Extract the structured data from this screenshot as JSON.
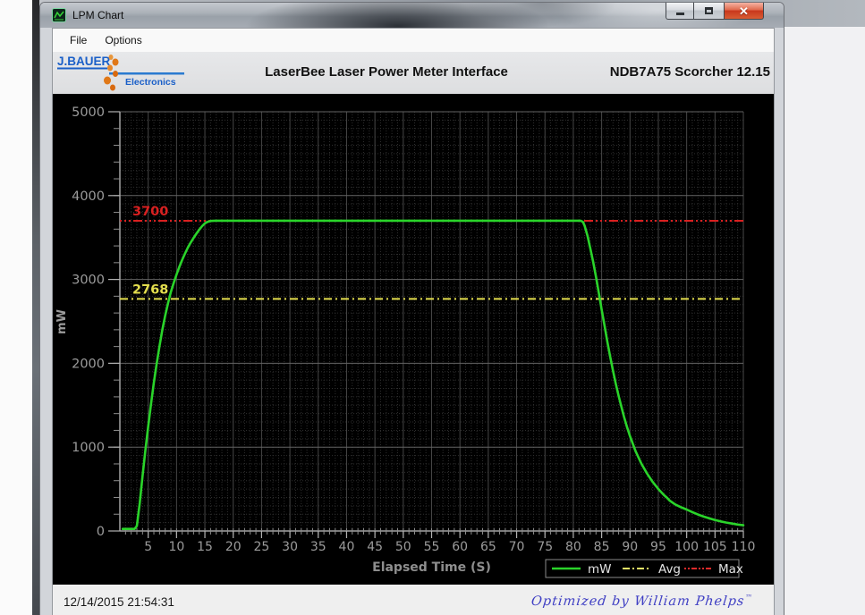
{
  "window": {
    "title": "LPM Chart",
    "buttons": {
      "minimize": "minimize",
      "maximize": "maximize",
      "close": "close"
    }
  },
  "menu": {
    "items": [
      {
        "label": "File"
      },
      {
        "label": "Options"
      }
    ]
  },
  "header": {
    "logo_line1": "J.BAUER",
    "logo_line2": "Electronics",
    "title": "LaserBee Laser Power Meter Interface",
    "version": "NDB7A75 Scorcher 12.15"
  },
  "statusbar": {
    "timestamp": "12/14/2015 21:54:31",
    "credit": "Optimized by William Phelps",
    "credit_tm": "TM"
  },
  "chart_data": {
    "type": "line",
    "xlabel": "Elapsed Time (S)",
    "ylabel": "mW",
    "xlim": [
      0,
      110
    ],
    "ylim": [
      0,
      5000
    ],
    "x_tick_labels": [
      5,
      10,
      15,
      20,
      25,
      30,
      35,
      40,
      45,
      50,
      55,
      60,
      65,
      70,
      75,
      80,
      85,
      90,
      95,
      100,
      105,
      110
    ],
    "y_tick_labels": [
      0,
      1000,
      2000,
      3000,
      4000,
      5000
    ],
    "x_minor_step": 1,
    "y_minor_step": 100,
    "grid": "major solid + minor dotted",
    "legend_position": "bottom-right",
    "legend": [
      {
        "name": "mW",
        "color": "#2ad42a",
        "style": "solid"
      },
      {
        "name": "Avg",
        "color": "#e9e966",
        "style": "dash-dot"
      },
      {
        "name": "Max",
        "color": "#e02a2a",
        "style": "dash-dot"
      }
    ],
    "max_line": {
      "value": 3700,
      "label": "3700",
      "color": "#d92020"
    },
    "avg_line": {
      "value": 2768,
      "label": "2768",
      "color": "#e3de4e"
    },
    "series": [
      {
        "name": "mW",
        "color": "#2ad42a",
        "points": [
          [
            0.5,
            25
          ],
          [
            2.6,
            25
          ],
          [
            3,
            60
          ],
          [
            3.5,
            330
          ],
          [
            4,
            650
          ],
          [
            4.5,
            960
          ],
          [
            5,
            1250
          ],
          [
            5.5,
            1520
          ],
          [
            6,
            1770
          ],
          [
            6.5,
            2000
          ],
          [
            7,
            2210
          ],
          [
            7.5,
            2400
          ],
          [
            8,
            2570
          ],
          [
            8.5,
            2720
          ],
          [
            9,
            2850
          ],
          [
            9.5,
            2960
          ],
          [
            10,
            3060
          ],
          [
            10.5,
            3150
          ],
          [
            11,
            3235
          ],
          [
            11.5,
            3310
          ],
          [
            12,
            3380
          ],
          [
            12.5,
            3440
          ],
          [
            13,
            3495
          ],
          [
            13.5,
            3545
          ],
          [
            14,
            3593
          ],
          [
            14.5,
            3635
          ],
          [
            15,
            3668
          ],
          [
            15.5,
            3688
          ],
          [
            16,
            3697
          ],
          [
            16.8,
            3700
          ],
          [
            81.3,
            3700
          ],
          [
            81.7,
            3685
          ],
          [
            82,
            3640
          ],
          [
            82.5,
            3520
          ],
          [
            83,
            3370
          ],
          [
            83.5,
            3210
          ],
          [
            84,
            3030
          ],
          [
            84.5,
            2840
          ],
          [
            85,
            2640
          ],
          [
            85.5,
            2450
          ],
          [
            86,
            2260
          ],
          [
            86.5,
            2080
          ],
          [
            87,
            1910
          ],
          [
            87.5,
            1755
          ],
          [
            88,
            1610
          ],
          [
            88.5,
            1475
          ],
          [
            89,
            1350
          ],
          [
            89.5,
            1235
          ],
          [
            90,
            1130
          ],
          [
            91,
            950
          ],
          [
            92,
            805
          ],
          [
            93,
            685
          ],
          [
            94,
            585
          ],
          [
            95,
            500
          ],
          [
            96,
            428
          ],
          [
            96.5,
            398
          ],
          [
            97,
            362
          ],
          [
            98,
            316
          ],
          [
            99,
            284
          ],
          [
            100,
            256
          ],
          [
            101,
            225
          ],
          [
            102,
            196
          ],
          [
            103,
            172
          ],
          [
            104,
            150
          ],
          [
            105,
            131
          ],
          [
            106,
            114
          ],
          [
            107,
            100
          ],
          [
            108,
            88
          ],
          [
            109,
            77
          ],
          [
            110,
            68
          ]
        ]
      }
    ]
  }
}
